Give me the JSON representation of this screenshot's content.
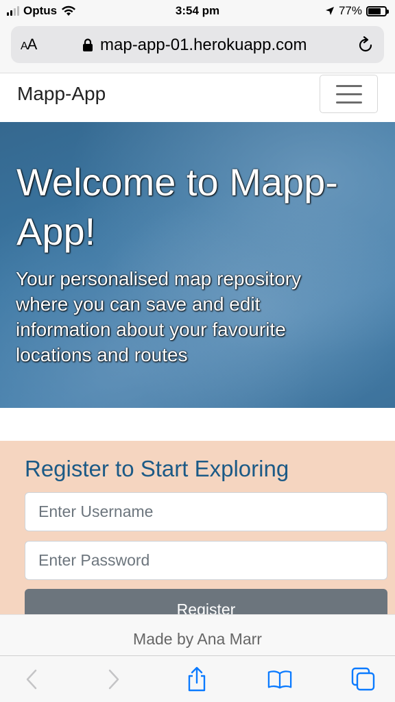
{
  "status_bar": {
    "carrier": "Optus",
    "time": "3:54 pm",
    "battery": "77%",
    "battery_level": 0.77
  },
  "browser": {
    "text_size_label_small": "A",
    "text_size_label_large": "A",
    "url": "map-app-01.herokuapp.com"
  },
  "navbar": {
    "brand": "Mapp-App"
  },
  "hero": {
    "title": "Welcome to Mapp-App!",
    "subtitle": "Your personalised map repository where you can save and edit information about your favourite locations and routes"
  },
  "register": {
    "heading": "Register to Start Exploring",
    "username_placeholder": "Enter Username",
    "password_placeholder": "Enter Password",
    "button_label": "Register"
  },
  "footer": {
    "text": "Made by Ana Marr"
  },
  "colors": {
    "accent_heading": "#1c5a86",
    "register_bg": "#f5d5c0",
    "button_bg": "#6c757d",
    "ios_blue": "#0a7aff"
  }
}
